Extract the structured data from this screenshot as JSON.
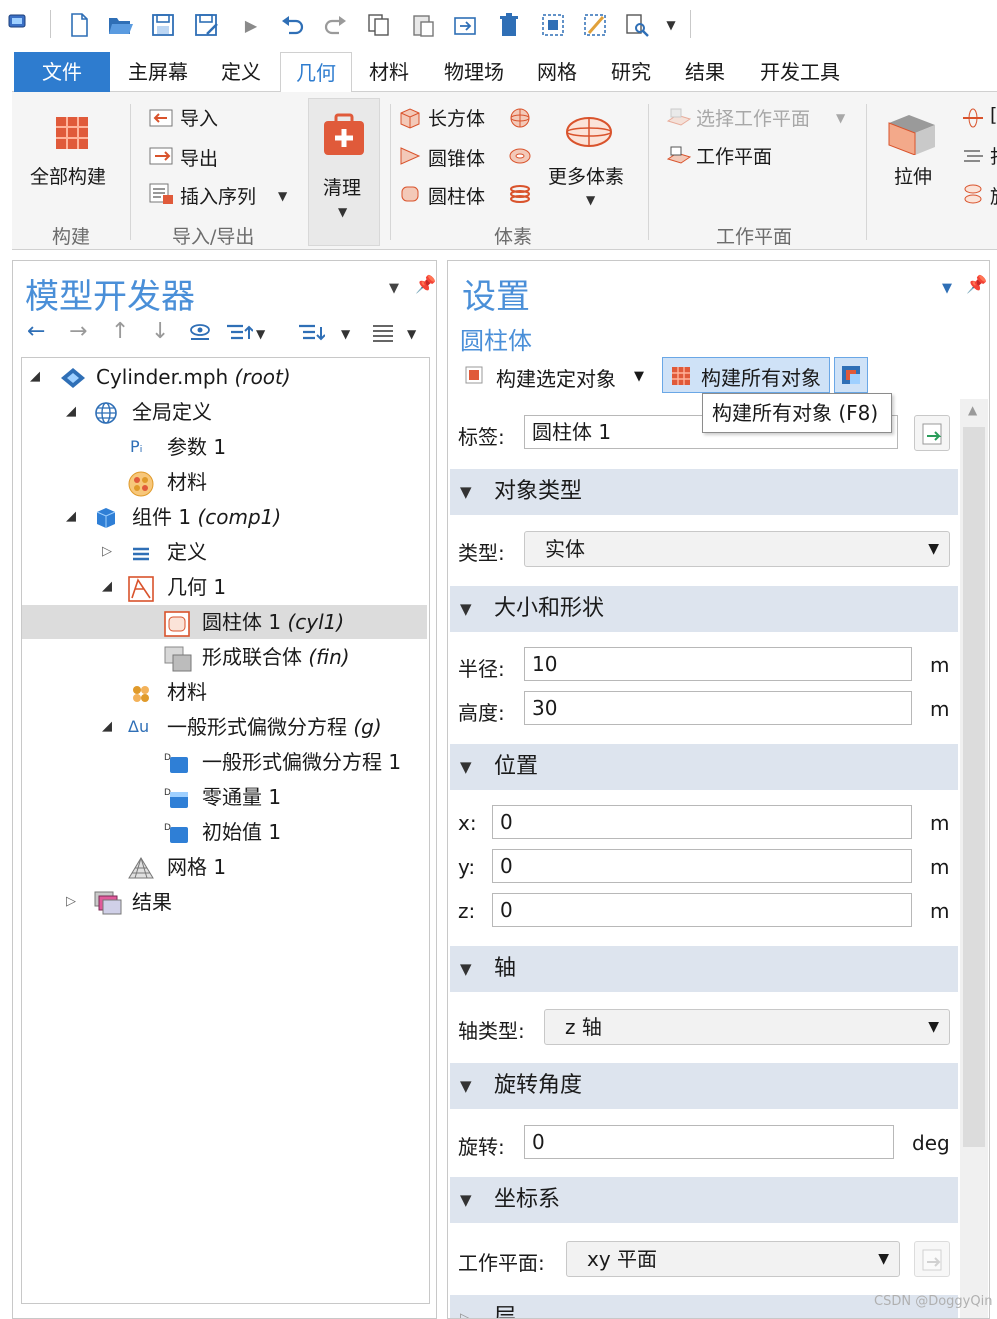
{
  "quick_access": {
    "icons": [
      "app-icon",
      "new-file-icon",
      "open-folder-icon",
      "save-icon",
      "save-as-icon",
      "run-icon",
      "undo-icon",
      "redo-icon",
      "copy-icon",
      "paste-icon",
      "duplicate-icon",
      "delete-icon",
      "select-all-icon",
      "deselect-icon",
      "find-icon",
      "dropdown-icon"
    ]
  },
  "ribbon_tabs": {
    "file": "文件",
    "home": "主屏幕",
    "definitions": "定义",
    "geometry": "几何",
    "materials": "材料",
    "physics": "物理场",
    "mesh": "网格",
    "study": "研究",
    "results": "结果",
    "developer": "开发工具"
  },
  "ribbon": {
    "build_all": "全部构建",
    "group_build": "构建",
    "import": "导入",
    "export": "导出",
    "insert_sequence": "插入序列",
    "group_import_export": "导入/导出",
    "cleanup": "清理",
    "block": "长方体",
    "cone": "圆锥体",
    "cylinder": "圆柱体",
    "more_primitives": "更多体素",
    "group_primitives": "体素",
    "select_work_plane": "选择工作平面",
    "work_plane": "工作平面",
    "group_work_plane": "工作平面",
    "extrude": "拉伸",
    "cut_letter_1": "[",
    "cut_letter_2": "扫",
    "cut_letter_3": "旋"
  },
  "model_builder": {
    "title": "模型开发器",
    "tree": {
      "root_name": "Cylinder.mph",
      "root_tag": "(root)",
      "global_definitions": "全局定义",
      "parameters": "参数 1",
      "global_materials": "材料",
      "component_name": "组件 1",
      "component_tag": "(comp1)",
      "definitions": "定义",
      "geometry": "几何 1",
      "cylinder": "圆柱体 1",
      "cylinder_tag": "(cyl1)",
      "form_union": "形成联合体",
      "form_union_tag": "(fin)",
      "materials": "材料",
      "general_pde": "一般形式偏微分方程",
      "general_pde_tag": "(g)",
      "general_pde_1": "一般形式偏微分方程 1",
      "zero_flux": "零通量 1",
      "initial_values": "初始值 1",
      "mesh": "网格 1",
      "results": "结果"
    }
  },
  "settings": {
    "title": "设置",
    "subtitle": "圆柱体",
    "build_selected": "构建选定对象",
    "build_all_objects": "构建所有对象",
    "tooltip": "构建所有对象 (F8)",
    "label_caption": "标签:",
    "label_value": "圆柱体 1",
    "section_object_type": "对象类型",
    "type_caption": "类型:",
    "type_value": "实体",
    "section_size_shape": "大小和形状",
    "radius_caption": "半径:",
    "radius_value": "10",
    "radius_unit": "m",
    "height_caption": "高度:",
    "height_value": "30",
    "height_unit": "m",
    "section_position": "位置",
    "x_caption": "x:",
    "x_value": "0",
    "x_unit": "m",
    "y_caption": "y:",
    "y_value": "0",
    "y_unit": "m",
    "z_caption": "z:",
    "z_value": "0",
    "z_unit": "m",
    "section_axis": "轴",
    "axis_type_caption": "轴类型:",
    "axis_type_value": "z 轴",
    "section_rotation": "旋转角度",
    "rotation_caption": "旋转:",
    "rotation_value": "0",
    "rotation_unit": "deg",
    "section_coordinate_system": "坐标系",
    "work_plane_caption": "工作平面:",
    "work_plane_value": "xy 平面",
    "section_layers_partial": "层"
  },
  "watermark": "CSDN @DoggyQin",
  "colors": {
    "accent": "#2e7ccf",
    "panel_title": "#4a8fd8",
    "section_bg": "#dde4ee",
    "selection_bg": "#dcdcdc"
  }
}
